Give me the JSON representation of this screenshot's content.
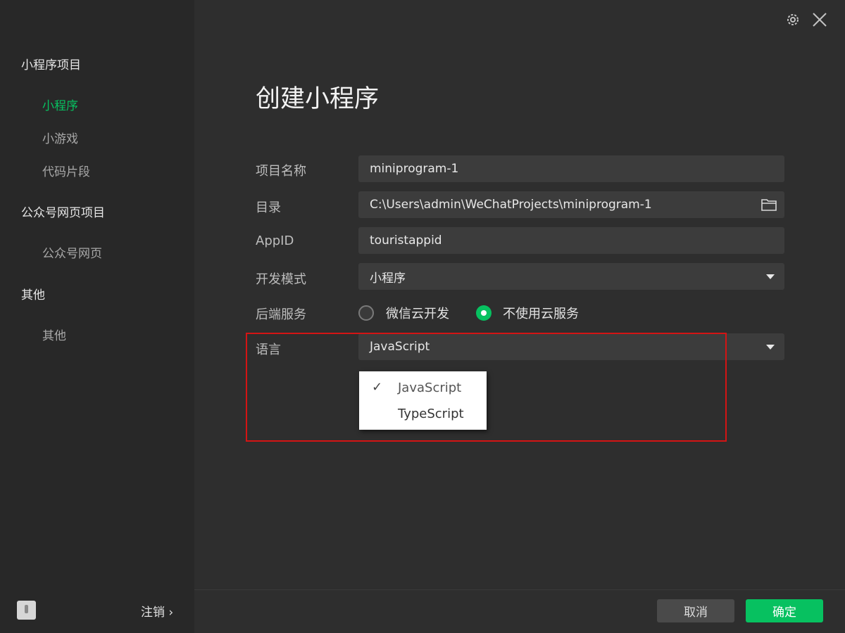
{
  "sidebar": {
    "groups": [
      {
        "label": "小程序项目",
        "items": [
          "小程序",
          "小游戏",
          "代码片段"
        ]
      },
      {
        "label": "公众号网页项目",
        "items": [
          "公众号网页"
        ]
      },
      {
        "label": "其他",
        "items": [
          "其他"
        ]
      }
    ],
    "active_item": "小程序",
    "logout_label": "注销 ›"
  },
  "header": {
    "settings_icon": "gear-icon",
    "close_icon": "close-icon"
  },
  "form": {
    "title": "创建小程序",
    "project_name": {
      "label": "项目名称",
      "value": "miniprogram-1"
    },
    "directory": {
      "label": "目录",
      "value": "C:\\Users\\admin\\WeChatProjects\\miniprogram-1"
    },
    "appid": {
      "label": "AppID",
      "value": "touristappid"
    },
    "dev_mode": {
      "label": "开发模式",
      "value": "小程序"
    },
    "backend": {
      "label": "后端服务",
      "options": [
        "微信云开发",
        "不使用云服务"
      ],
      "selected": "不使用云服务"
    },
    "language": {
      "label": "语言",
      "value": "JavaScript",
      "options": [
        "JavaScript",
        "TypeScript"
      ],
      "selected": "JavaScript"
    }
  },
  "footer": {
    "cancel_label": "取消",
    "ok_label": "确定"
  },
  "colors": {
    "accent": "#07c160",
    "highlight_border": "#d41414",
    "background": "#2e2e2e"
  }
}
